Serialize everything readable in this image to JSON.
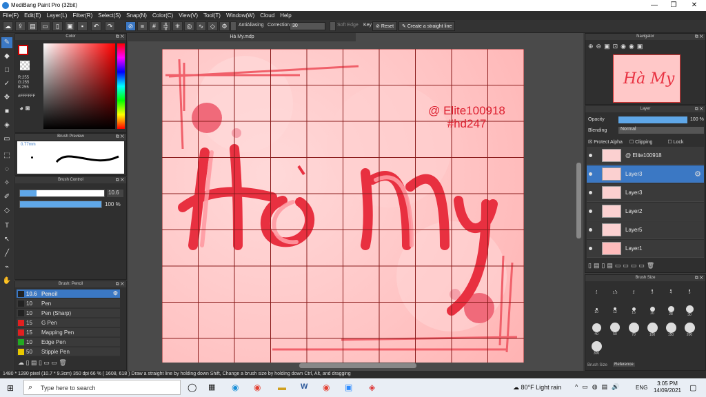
{
  "titlebar": {
    "title": "MediBang Paint Pro (32bit)",
    "min": "—",
    "max": "❐",
    "close": "✕"
  },
  "menu": [
    "File(F)",
    "Edit(E)",
    "Layer(L)",
    "Filter(R)",
    "Select(S)",
    "Snap(N)",
    "Color(C)",
    "View(V)",
    "Tool(T)",
    "Window(W)",
    "Cloud",
    "Help"
  ],
  "toolbar": {
    "antialias": "AntiAliasing",
    "correction_label": "Correction",
    "correction_value": "30",
    "soft_edge": "Soft Edge",
    "key": "Key",
    "reset": "Reset",
    "straight_line": "Create a straight line"
  },
  "color_panel": {
    "title": "Color",
    "r": "R:255",
    "g": "G:255",
    "b": "B:255",
    "hex": "#FFFFFF"
  },
  "brush_preview": {
    "title": "Brush Preview",
    "size": "0.77mm"
  },
  "brush_control": {
    "title": "Brush Control",
    "size": "10.6",
    "opacity": "100 %"
  },
  "brush_list": {
    "title": "Brush: Pencil",
    "items": [
      {
        "size": "10.6",
        "name": "Pencil",
        "color": "#222222"
      },
      {
        "size": "10",
        "name": "Pen",
        "color": "#222222"
      },
      {
        "size": "10",
        "name": "Pen (Sharp)",
        "color": "#222222"
      },
      {
        "size": "15",
        "name": "G Pen",
        "color": "#e02020"
      },
      {
        "size": "15",
        "name": "Mapping Pen",
        "color": "#e02020"
      },
      {
        "size": "10",
        "name": "Edge Pen",
        "color": "#22aa22"
      },
      {
        "size": "50",
        "name": "Stipple Pen",
        "color": "#e8c800"
      }
    ]
  },
  "document": {
    "tab": "Hà My.mdp"
  },
  "artwork": {
    "handle": "@ Elite100918",
    "tag": "#hd247",
    "lettering": "Hà My"
  },
  "navigator": {
    "title": "Navigator"
  },
  "layer_panel": {
    "title": "Layer",
    "opacity_label": "Opacity",
    "opacity_value": "100 %",
    "blending_label": "Blending",
    "blending_value": "Normal",
    "protect_alpha": "Protect Alpha",
    "clipping": "Clipping",
    "lock": "Lock",
    "layers": [
      "@ Elite100918",
      "Layer3",
      "Layer3",
      "Layer2",
      "Layer5",
      "Layer1"
    ]
  },
  "brush_size": {
    "title": "Brush Size",
    "labels": [
      "1",
      "1.5",
      "2",
      "3",
      "4",
      "5",
      "10",
      "12",
      "15",
      "20",
      "28",
      "30",
      "40",
      "50",
      "70",
      "100",
      "150",
      "200",
      "300"
    ],
    "tab_a": "Brush Size",
    "tab_b": "Reference"
  },
  "status": {
    "text": "1480 * 1280 pixel   (10.7 * 9.3cm)   350 dpi   66 %   ( 1608, 618 )   Draw a straight line by holding down Shift, Change a brush size by holding down Ctrl, Alt, and dragging"
  },
  "taskbar": {
    "search": "Type here to search",
    "weather": "80°F  Light rain",
    "lang": "ENG",
    "time": "3:05 PM",
    "date": "14/09/2021"
  }
}
